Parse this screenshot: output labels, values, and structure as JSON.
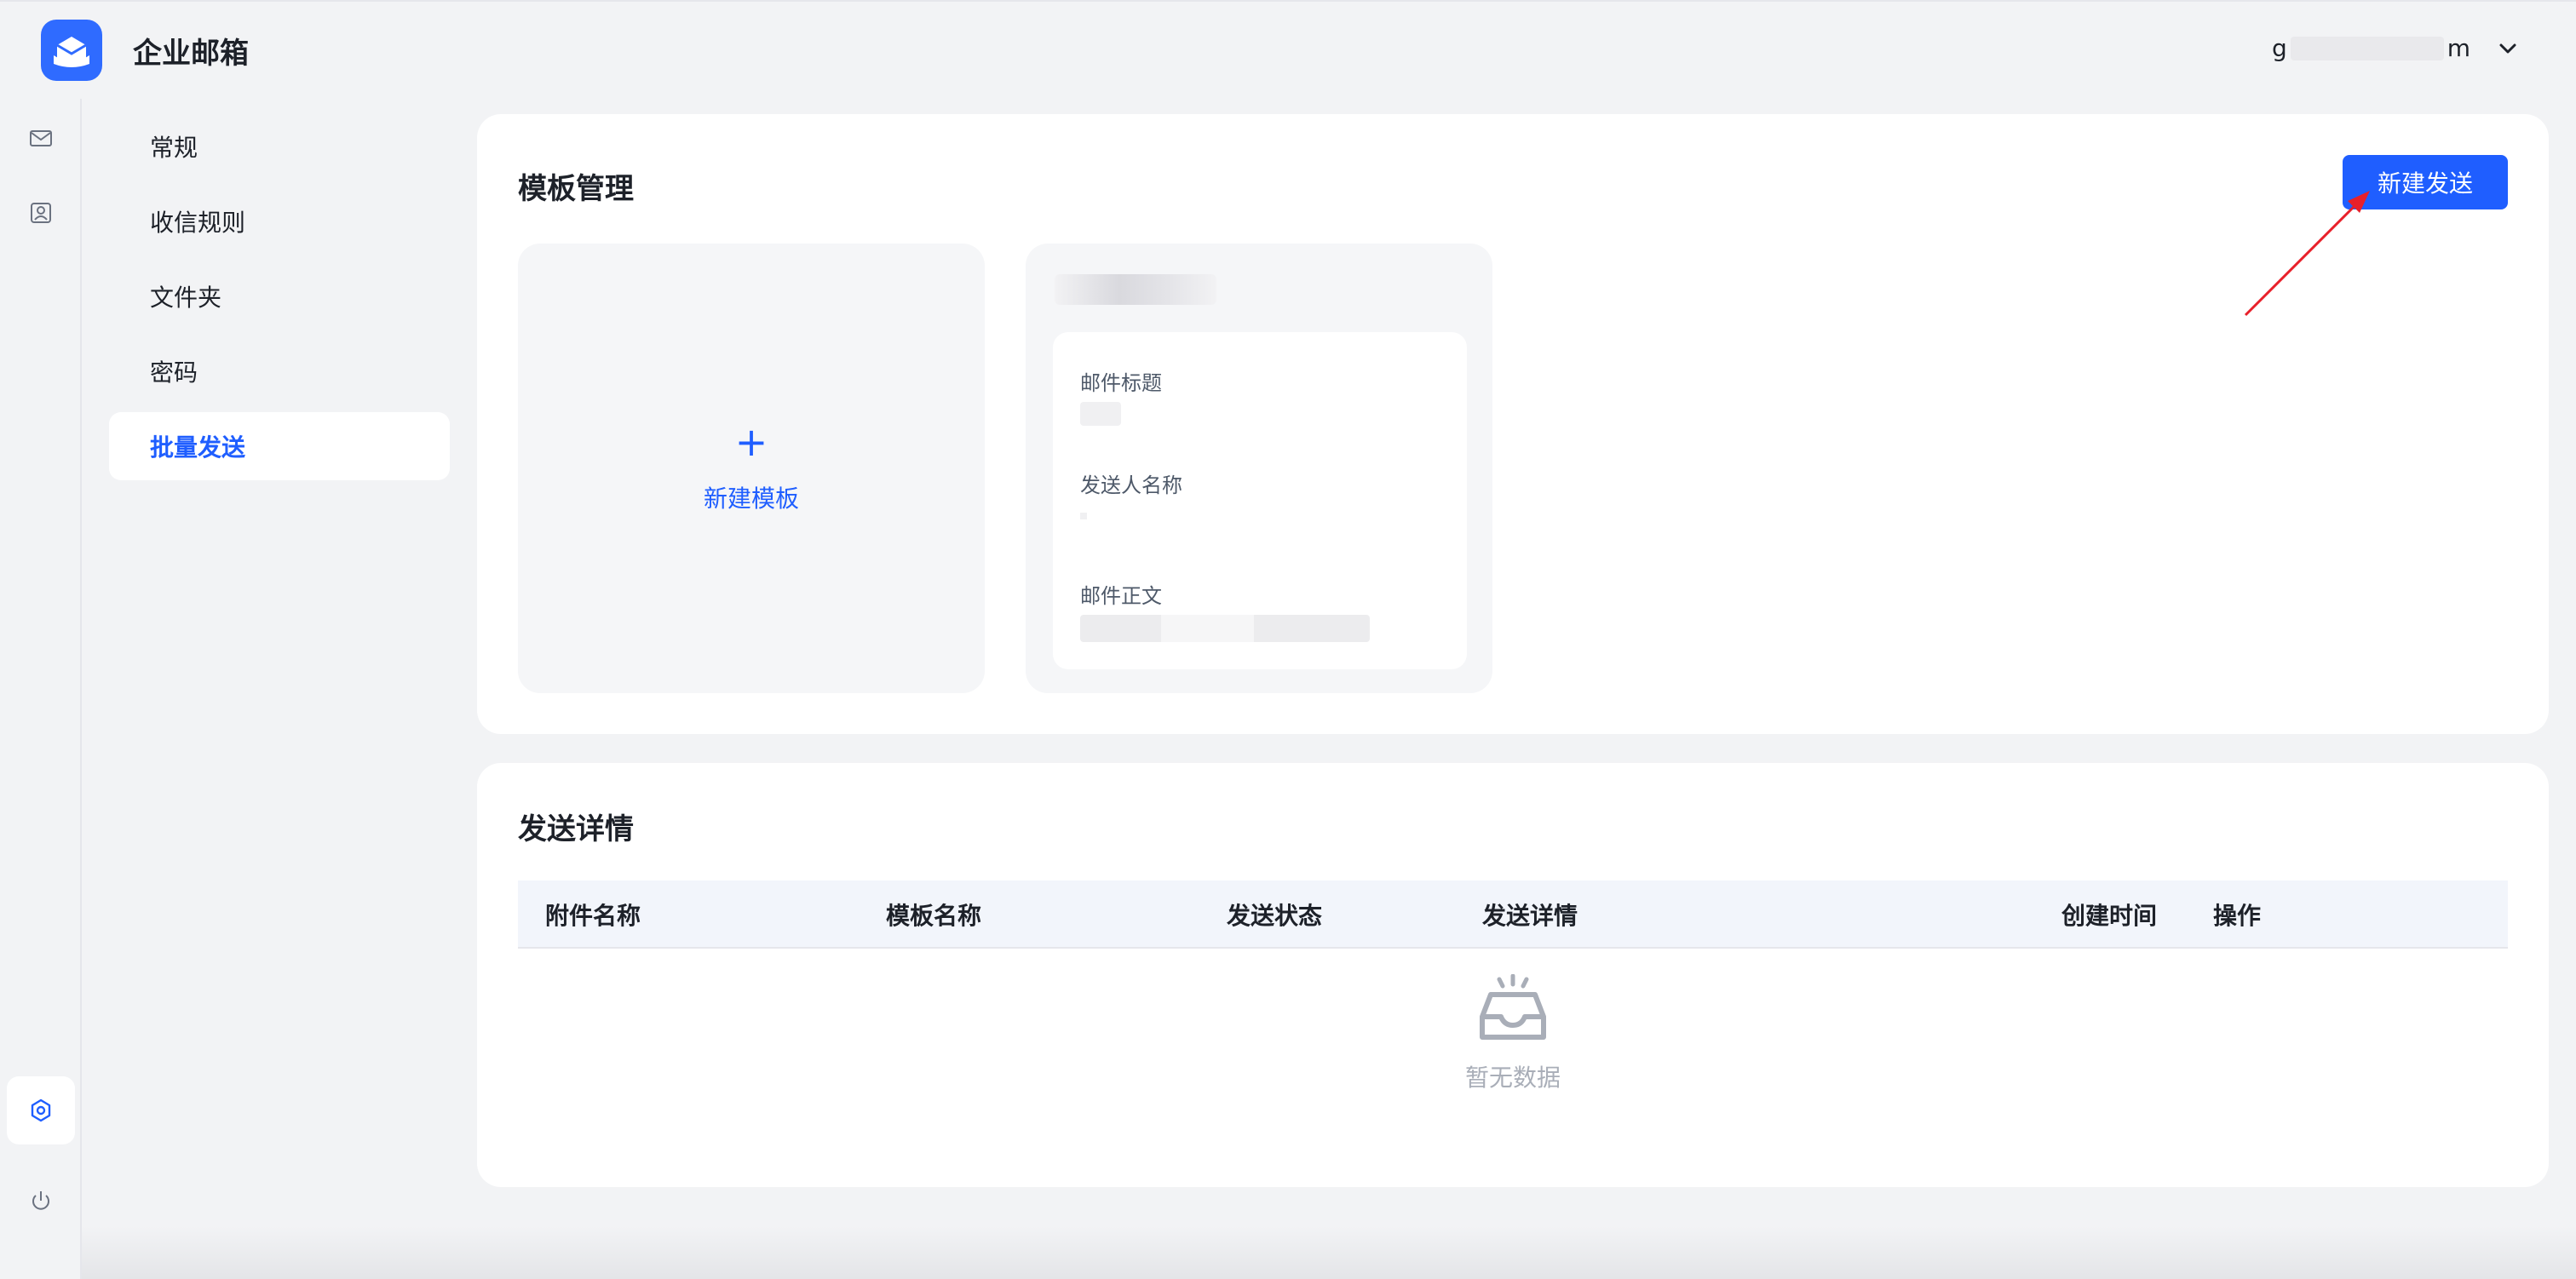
{
  "header": {
    "app_title": "企业邮箱",
    "user_prefix": "g",
    "user_suffix": "m"
  },
  "rail": {
    "icons": [
      "mail-icon",
      "contacts-icon",
      "settings-icon",
      "power-icon"
    ],
    "active": "settings-icon"
  },
  "nav": {
    "items": [
      {
        "label": "常规"
      },
      {
        "label": "收信规则"
      },
      {
        "label": "文件夹"
      },
      {
        "label": "密码"
      },
      {
        "label": "批量发送"
      }
    ],
    "active_index": 4
  },
  "template_section": {
    "title": "模板管理",
    "new_send_button": "新建发送",
    "new_template_label": "新建模板",
    "new_template_plus": "+",
    "fields": {
      "subject_label": "邮件标题",
      "sender_label": "发送人名称",
      "body_label": "邮件正文"
    }
  },
  "send_section": {
    "title": "发送详情",
    "columns": [
      "附件名称",
      "模板名称",
      "发送状态",
      "发送详情",
      "创建时间",
      "操作"
    ],
    "empty_text": "暂无数据"
  },
  "colors": {
    "primary": "#1f5eff",
    "annotation_arrow": "#e8202a"
  }
}
